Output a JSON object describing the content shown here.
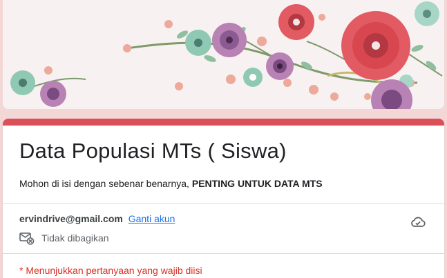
{
  "form": {
    "title": "Data Populasi MTs ( Siswa)",
    "description_plain": "Mohon di isi dengan sebenar benarnya, ",
    "description_bold": "PENTING UNTUK DATA MTS",
    "accent_color": "#db4f56"
  },
  "account": {
    "email": "ervindrive@gmail.com",
    "switch_label": "Ganti akun",
    "share_status": "Tidak dibagikan",
    "share_icon": "mail-not-shared-icon",
    "save_icon": "cloud-icon"
  },
  "required_note": "* Menunjukkan pertanyaan yang wajib diisi"
}
